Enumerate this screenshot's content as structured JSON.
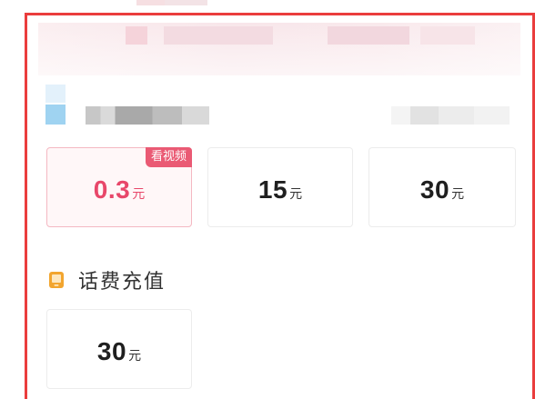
{
  "offer_cards": [
    {
      "amount": "0.3",
      "unit": "元",
      "badge": "看视频",
      "selected": true
    },
    {
      "amount": "15",
      "unit": "元",
      "selected": false
    },
    {
      "amount": "30",
      "unit": "元",
      "selected": false
    }
  ],
  "phone_recharge": {
    "title": "话费充值",
    "icon": "phone-icon",
    "cards": [
      {
        "amount": "30",
        "unit": "元"
      }
    ]
  },
  "colors": {
    "frame_border": "#ea3d3d",
    "accent": "#e8476a",
    "badge_bg": "#ea5a74",
    "icon": "#f2a52f"
  }
}
